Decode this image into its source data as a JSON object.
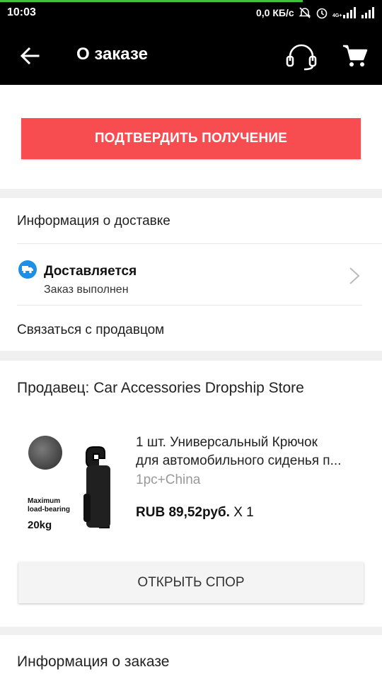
{
  "status_bar": {
    "time": "10:03",
    "network_speed": "0,0 КБ/с",
    "icons": [
      "mute-icon",
      "alarm-icon",
      "signal-4g-icon",
      "signal-icon"
    ],
    "network_type": "4G+"
  },
  "app_bar": {
    "title": "О заказе",
    "icons": [
      "back-arrow-icon",
      "headset-support-icon",
      "cart-icon"
    ]
  },
  "actions": {
    "confirm_label": "ПОДТВЕРДИТЬ ПОЛУЧЕНИЕ",
    "dispute_label": "ОТКРЫТЬ СПОР"
  },
  "delivery": {
    "section_title": "Информация о доставке",
    "status_title": "Доставляется",
    "status_subtitle": "Заказ выполнен",
    "contact_seller": "Связаться с продавцом"
  },
  "seller": {
    "label": "Продавец: Car Accessories Dropship Store"
  },
  "product": {
    "title_line1": "1 шт. Универсальный Крючок",
    "title_line2": "для автомобильного сиденья п...",
    "variant": "1pc+China",
    "price": "RUB 89,52руб.",
    "quantity": "X 1",
    "image_text_line1": "Maximum",
    "image_text_line2": "load-bearing",
    "image_text_weight": "20kg"
  },
  "order_info": {
    "section_title": "Информация о заказе"
  },
  "colors": {
    "accent_red": "#f74d51",
    "status_blue": "#1e8fe6",
    "header_black": "#000000"
  }
}
